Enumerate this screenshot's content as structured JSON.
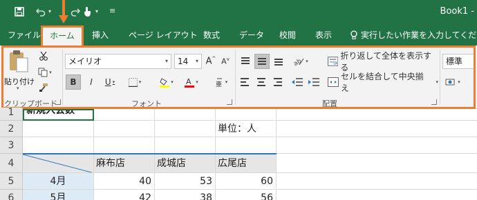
{
  "colors": {
    "excel_green": "#217346",
    "highlight_orange": "#ed7d31",
    "header_blue": "#2e75b6",
    "month_fill": "#ddebf7"
  },
  "window": {
    "title": "Book1 -"
  },
  "qat": {
    "icons": [
      "save-icon",
      "undo-icon",
      "redo-icon",
      "touch-mode-icon",
      "customize-caret-icon"
    ]
  },
  "tabs": {
    "file": "ファイル",
    "home": "ホーム",
    "insert": "挿入",
    "page_layout": "ページ レイアウト",
    "formulas": "数式",
    "data": "データ",
    "review": "校閲",
    "view": "表示",
    "tell_me": "実行したい作業を入力してください"
  },
  "ribbon": {
    "clipboard": {
      "paste_label": "貼り付け",
      "group_label": "クリップボード"
    },
    "font": {
      "font_name": "メイリオ",
      "font_size": "14",
      "bold": "B",
      "italic": "I",
      "underline": "U",
      "fill_color": "#ffff00",
      "font_color": "#ff0000",
      "group_label": "フォント"
    },
    "alignment": {
      "wrap_text": "折り返して全体を表示する",
      "merge_center": "セルを結合して中央揃え",
      "group_label": "配置"
    },
    "number": {
      "format": "標準"
    }
  },
  "sheet": {
    "rows": [
      "1",
      "2",
      "3",
      "4",
      "5",
      "6"
    ],
    "a1": "新規入会数",
    "unit_label": "単位：人",
    "store_headers": [
      "麻布店",
      "成城店",
      "広尾店"
    ],
    "months": [
      "4月",
      "5月"
    ],
    "values": [
      [
        "40",
        "53",
        "60"
      ],
      [
        "42",
        "38",
        "56"
      ]
    ]
  }
}
